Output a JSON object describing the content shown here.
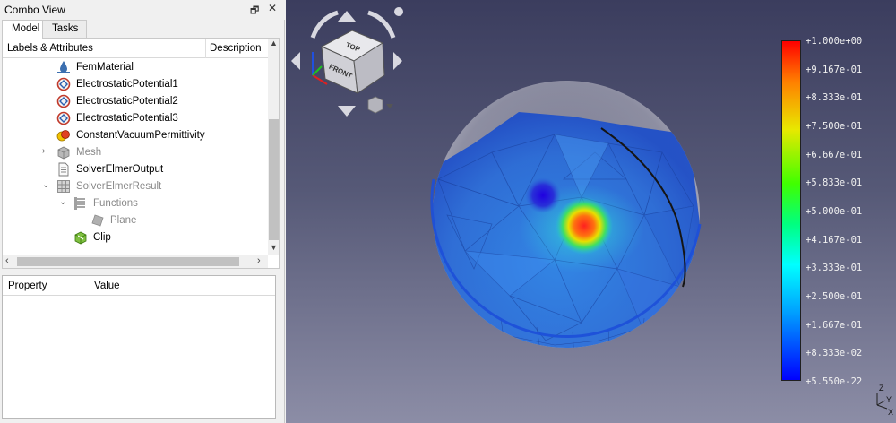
{
  "combo": {
    "title": "Combo View",
    "float_btn": "🗗",
    "close_btn": "✕",
    "tabs": [
      {
        "label": "Model"
      },
      {
        "label": "Tasks"
      }
    ],
    "tree": {
      "col_labels": "Labels & Attributes",
      "col_description": "Description",
      "items": [
        {
          "label": "FemMaterial"
        },
        {
          "label": "ElectrostaticPotential1"
        },
        {
          "label": "ElectrostaticPotential2"
        },
        {
          "label": "ElectrostaticPotential3"
        },
        {
          "label": "ConstantVacuumPermittivity"
        },
        {
          "label": "Mesh"
        },
        {
          "label": "SolverElmerOutput"
        },
        {
          "label": "SolverElmerResult"
        },
        {
          "label": "Functions"
        },
        {
          "label": "Plane"
        },
        {
          "label": "Clip"
        }
      ]
    },
    "props": {
      "col_property": "Property",
      "col_value": "Value"
    }
  },
  "navcube": {
    "face_top": "TOP",
    "face_front": "FRONT"
  },
  "legend": {
    "labels": [
      "+1.000e+00",
      "+9.167e-01",
      "+8.333e-01",
      "+7.500e-01",
      "+6.667e-01",
      "+5.833e-01",
      "+5.000e-01",
      "+4.167e-01",
      "+3.333e-01",
      "+2.500e-01",
      "+1.667e-01",
      "+8.333e-02",
      "+5.550e-22"
    ]
  },
  "axis": {
    "z": "Z",
    "x": "X",
    "y": "Y"
  },
  "colors": {
    "viewport_top": "#3b3d5e",
    "viewport_bottom": "#8c8da6",
    "mesh_blue": "#2f6fe0",
    "hotspot": "#ff3020"
  }
}
